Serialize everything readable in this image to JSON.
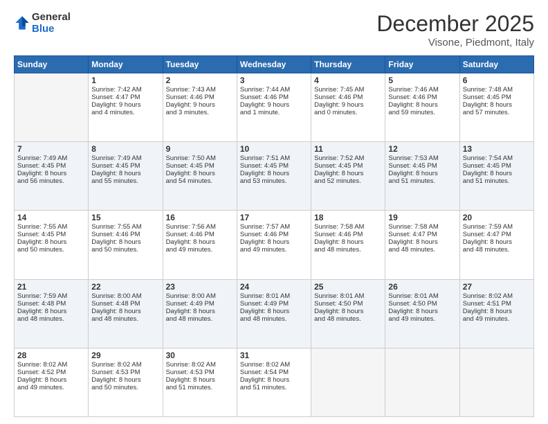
{
  "header": {
    "logo_line1": "General",
    "logo_line2": "Blue",
    "month": "December 2025",
    "location": "Visone, Piedmont, Italy"
  },
  "weekdays": [
    "Sunday",
    "Monday",
    "Tuesday",
    "Wednesday",
    "Thursday",
    "Friday",
    "Saturday"
  ],
  "weeks": [
    [
      {
        "day": "",
        "data": ""
      },
      {
        "day": "1",
        "data": "Sunrise: 7:42 AM\nSunset: 4:47 PM\nDaylight: 9 hours\nand 4 minutes."
      },
      {
        "day": "2",
        "data": "Sunrise: 7:43 AM\nSunset: 4:46 PM\nDaylight: 9 hours\nand 3 minutes."
      },
      {
        "day": "3",
        "data": "Sunrise: 7:44 AM\nSunset: 4:46 PM\nDaylight: 9 hours\nand 1 minute."
      },
      {
        "day": "4",
        "data": "Sunrise: 7:45 AM\nSunset: 4:46 PM\nDaylight: 9 hours\nand 0 minutes."
      },
      {
        "day": "5",
        "data": "Sunrise: 7:46 AM\nSunset: 4:46 PM\nDaylight: 8 hours\nand 59 minutes."
      },
      {
        "day": "6",
        "data": "Sunrise: 7:48 AM\nSunset: 4:45 PM\nDaylight: 8 hours\nand 57 minutes."
      }
    ],
    [
      {
        "day": "7",
        "data": "Sunrise: 7:49 AM\nSunset: 4:45 PM\nDaylight: 8 hours\nand 56 minutes."
      },
      {
        "day": "8",
        "data": "Sunrise: 7:49 AM\nSunset: 4:45 PM\nDaylight: 8 hours\nand 55 minutes."
      },
      {
        "day": "9",
        "data": "Sunrise: 7:50 AM\nSunset: 4:45 PM\nDaylight: 8 hours\nand 54 minutes."
      },
      {
        "day": "10",
        "data": "Sunrise: 7:51 AM\nSunset: 4:45 PM\nDaylight: 8 hours\nand 53 minutes."
      },
      {
        "day": "11",
        "data": "Sunrise: 7:52 AM\nSunset: 4:45 PM\nDaylight: 8 hours\nand 52 minutes."
      },
      {
        "day": "12",
        "data": "Sunrise: 7:53 AM\nSunset: 4:45 PM\nDaylight: 8 hours\nand 51 minutes."
      },
      {
        "day": "13",
        "data": "Sunrise: 7:54 AM\nSunset: 4:45 PM\nDaylight: 8 hours\nand 51 minutes."
      }
    ],
    [
      {
        "day": "14",
        "data": "Sunrise: 7:55 AM\nSunset: 4:45 PM\nDaylight: 8 hours\nand 50 minutes."
      },
      {
        "day": "15",
        "data": "Sunrise: 7:55 AM\nSunset: 4:46 PM\nDaylight: 8 hours\nand 50 minutes."
      },
      {
        "day": "16",
        "data": "Sunrise: 7:56 AM\nSunset: 4:46 PM\nDaylight: 8 hours\nand 49 minutes."
      },
      {
        "day": "17",
        "data": "Sunrise: 7:57 AM\nSunset: 4:46 PM\nDaylight: 8 hours\nand 49 minutes."
      },
      {
        "day": "18",
        "data": "Sunrise: 7:58 AM\nSunset: 4:46 PM\nDaylight: 8 hours\nand 48 minutes."
      },
      {
        "day": "19",
        "data": "Sunrise: 7:58 AM\nSunset: 4:47 PM\nDaylight: 8 hours\nand 48 minutes."
      },
      {
        "day": "20",
        "data": "Sunrise: 7:59 AM\nSunset: 4:47 PM\nDaylight: 8 hours\nand 48 minutes."
      }
    ],
    [
      {
        "day": "21",
        "data": "Sunrise: 7:59 AM\nSunset: 4:48 PM\nDaylight: 8 hours\nand 48 minutes."
      },
      {
        "day": "22",
        "data": "Sunrise: 8:00 AM\nSunset: 4:48 PM\nDaylight: 8 hours\nand 48 minutes."
      },
      {
        "day": "23",
        "data": "Sunrise: 8:00 AM\nSunset: 4:49 PM\nDaylight: 8 hours\nand 48 minutes."
      },
      {
        "day": "24",
        "data": "Sunrise: 8:01 AM\nSunset: 4:49 PM\nDaylight: 8 hours\nand 48 minutes."
      },
      {
        "day": "25",
        "data": "Sunrise: 8:01 AM\nSunset: 4:50 PM\nDaylight: 8 hours\nand 48 minutes."
      },
      {
        "day": "26",
        "data": "Sunrise: 8:01 AM\nSunset: 4:50 PM\nDaylight: 8 hours\nand 49 minutes."
      },
      {
        "day": "27",
        "data": "Sunrise: 8:02 AM\nSunset: 4:51 PM\nDaylight: 8 hours\nand 49 minutes."
      }
    ],
    [
      {
        "day": "28",
        "data": "Sunrise: 8:02 AM\nSunset: 4:52 PM\nDaylight: 8 hours\nand 49 minutes."
      },
      {
        "day": "29",
        "data": "Sunrise: 8:02 AM\nSunset: 4:53 PM\nDaylight: 8 hours\nand 50 minutes."
      },
      {
        "day": "30",
        "data": "Sunrise: 8:02 AM\nSunset: 4:53 PM\nDaylight: 8 hours\nand 51 minutes."
      },
      {
        "day": "31",
        "data": "Sunrise: 8:02 AM\nSunset: 4:54 PM\nDaylight: 8 hours\nand 51 minutes."
      },
      {
        "day": "",
        "data": ""
      },
      {
        "day": "",
        "data": ""
      },
      {
        "day": "",
        "data": ""
      }
    ]
  ]
}
